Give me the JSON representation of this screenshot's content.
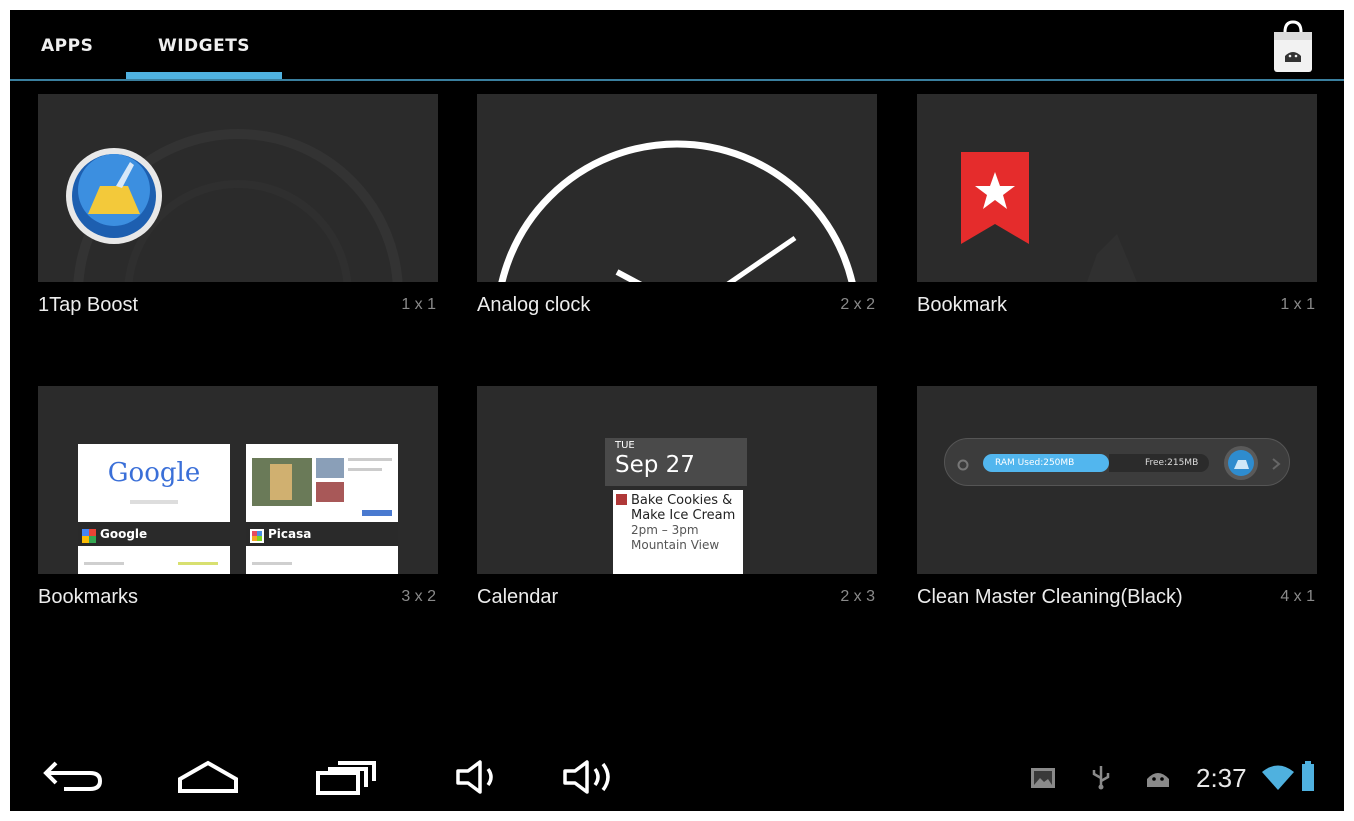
{
  "tabs": {
    "apps": "APPS",
    "widgets": "WIDGETS",
    "active": "WIDGETS"
  },
  "widgets": [
    {
      "name": "1Tap Boost",
      "size": "1 x 1"
    },
    {
      "name": "Analog clock",
      "size": "2 x 2"
    },
    {
      "name": "Bookmark",
      "size": "1 x 1"
    },
    {
      "name": "Bookmarks",
      "size": "3 x 2"
    },
    {
      "name": "Calendar",
      "size": "2 x 3"
    },
    {
      "name": "Clean Master Cleaning(Black)",
      "size": "4 x 1"
    }
  ],
  "bookmarks_preview": {
    "google_logo": "Google",
    "google_label": "Google",
    "picasa_label": "Picasa"
  },
  "calendar_preview": {
    "day_of_week": "TUE",
    "date": "Sep 27",
    "event_title": "Bake Cookies & Make Ice Cream",
    "event_time": "2pm – 3pm",
    "event_location": "Mountain View"
  },
  "clean_master_preview": {
    "ram_label": "RAM Used:250MB",
    "free_label": "Free:215MB"
  },
  "status_bar": {
    "time": "2:37"
  },
  "icons": {
    "store": "play-store-bag-icon",
    "back": "back-icon",
    "home": "home-icon",
    "recent": "recent-apps-icon",
    "volume_down": "volume-down-icon",
    "volume_up": "volume-up-icon",
    "gallery": "gallery-notification-icon",
    "usb": "usb-icon",
    "android": "android-debug-icon",
    "wifi": "wifi-icon",
    "battery": "battery-icon"
  },
  "colors": {
    "accent": "#4fb1df",
    "background": "#000000",
    "card": "#2b2b2b"
  }
}
